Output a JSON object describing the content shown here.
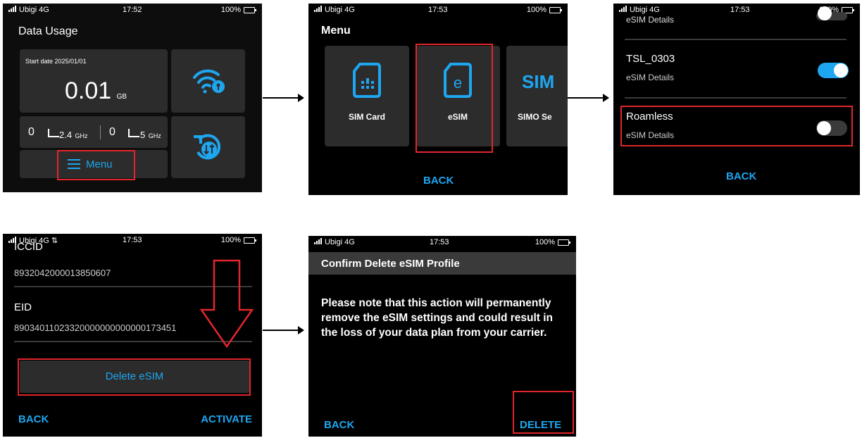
{
  "status": {
    "carrier": "Ubigi 4G",
    "carrier_alt": "Ubigi 4G ⇅",
    "battery": "100%",
    "time1": "17:52",
    "time2": "17:53"
  },
  "s1": {
    "title": "Data Usage",
    "start_date": "Start date 2025/01/01",
    "usage_value": "0.01",
    "usage_unit": "GB",
    "band1_count": "0",
    "band1_label": "2.4",
    "band1_unit": "GHz",
    "band2_count": "0",
    "band2_label": "5",
    "band2_unit": "GHz",
    "menu_label": "Menu"
  },
  "s2": {
    "title": "Menu",
    "tiles": [
      "SIM Card",
      "eSIM",
      "SIMO Se"
    ],
    "back": "BACK"
  },
  "s3": {
    "top_partial": "eSIM Details",
    "profiles": [
      {
        "name": "TSL_0303",
        "sub": "eSIM Details",
        "enabled": true
      },
      {
        "name": "Roamless",
        "sub": "eSIM Details",
        "enabled": false
      }
    ],
    "back": "BACK"
  },
  "s4": {
    "iccid_label": "ICCID",
    "iccid_value": "8932042000013850607",
    "eid_label": "EID",
    "eid_value": "89034011023320000000000000173451",
    "delete_label": "Delete eSIM",
    "back": "BACK",
    "activate": "ACTIVATE"
  },
  "s5": {
    "title": "Confirm Delete eSIM Profile",
    "message": "Please note that this action will permanently remove the eSIM settings and could result in the loss of your data plan from your carrier.",
    "back": "BACK",
    "delete": "DELETE"
  },
  "colors": {
    "accent": "#1ea6f0",
    "highlight": "#e0262c",
    "tile": "#2c2c2c"
  }
}
